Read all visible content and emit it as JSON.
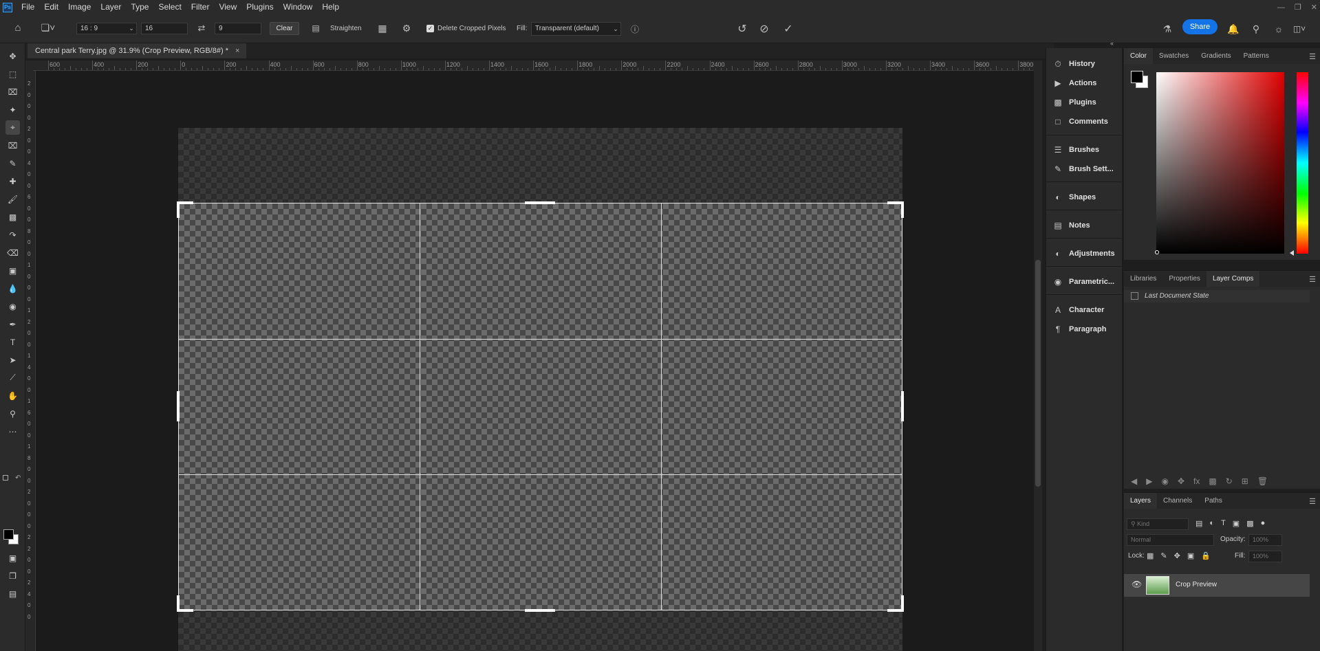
{
  "menubar": {
    "logo": "Ps",
    "items": [
      "File",
      "Edit",
      "Image",
      "Layer",
      "Type",
      "Select",
      "Filter",
      "View",
      "Plugins",
      "Window",
      "Help"
    ]
  },
  "options": {
    "ratio_preset": "16 : 9",
    "width_value": "16",
    "height_value": "9",
    "clear_label": "Clear",
    "straighten_label": "Straighten",
    "delete_cropped_label": "Delete Cropped Pixels",
    "delete_cropped_checked": true,
    "fill_label": "Fill:",
    "fill_value": "Transparent (default)",
    "share_label": "Share"
  },
  "document": {
    "tab_title": "Central park Terry.jpg @ 31.9% (Crop Preview, RGB/8#) *",
    "close": "×"
  },
  "ruler": {
    "top_labels": [
      "600",
      "400",
      "200",
      "0",
      "200",
      "400",
      "600",
      "800",
      "1000",
      "1200",
      "1400",
      "1600",
      "1800",
      "2000",
      "2200",
      "2400",
      "2600",
      "2800",
      "3000",
      "3200",
      "3400",
      "3600",
      "3800"
    ],
    "left_labels": [
      "2",
      "0",
      "0",
      "0",
      "2",
      "0",
      "0",
      "4",
      "0",
      "0",
      "6",
      "0",
      "0",
      "8",
      "0",
      "0",
      "1",
      "0",
      "0",
      "0",
      "1",
      "2",
      "0",
      "0",
      "1",
      "4",
      "0",
      "0",
      "1",
      "6",
      "0",
      "0",
      "1",
      "8",
      "0",
      "0",
      "2",
      "0",
      "0",
      "0",
      "2",
      "2",
      "0",
      "0",
      "2",
      "4",
      "0",
      "0"
    ]
  },
  "dock": {
    "items": [
      {
        "label": "History",
        "icon": "history-icon"
      },
      {
        "label": "Actions",
        "icon": "play-icon"
      },
      {
        "label": "Plugins",
        "icon": "plugin-icon"
      },
      {
        "label": "Comments",
        "icon": "comment-icon"
      },
      {
        "label": "Brushes",
        "icon": "brushes-icon"
      },
      {
        "label": "Brush Sett...",
        "icon": "brush-icon"
      },
      {
        "label": "Shapes",
        "icon": "shapes-icon"
      },
      {
        "label": "Notes",
        "icon": "notes-icon"
      },
      {
        "label": "Adjustments",
        "icon": "adjustments-icon"
      },
      {
        "label": "Parametric...",
        "icon": "parametric-icon"
      },
      {
        "label": "Character",
        "icon": "character-icon"
      },
      {
        "label": "Paragraph",
        "icon": "paragraph-icon"
      }
    ]
  },
  "color_panel": {
    "tabs": [
      "Color",
      "Swatches",
      "Gradients",
      "Patterns"
    ],
    "foreground": "#000000",
    "background": "#ffffff",
    "hue_color": "#e00000"
  },
  "comps_panel": {
    "tabs": [
      "Libraries",
      "Properties",
      "Layer Comps"
    ],
    "item": "Last Document State"
  },
  "layers_panel": {
    "tabs": [
      "Layers",
      "Channels",
      "Paths"
    ],
    "kind_placeholder": "Kind",
    "blend_mode": "Normal",
    "opacity_label": "Opacity:",
    "opacity_value": "100%",
    "lock_label": "Lock:",
    "fill_label": "Fill:",
    "fill_value": "100%",
    "layer_name": "Crop Preview"
  }
}
